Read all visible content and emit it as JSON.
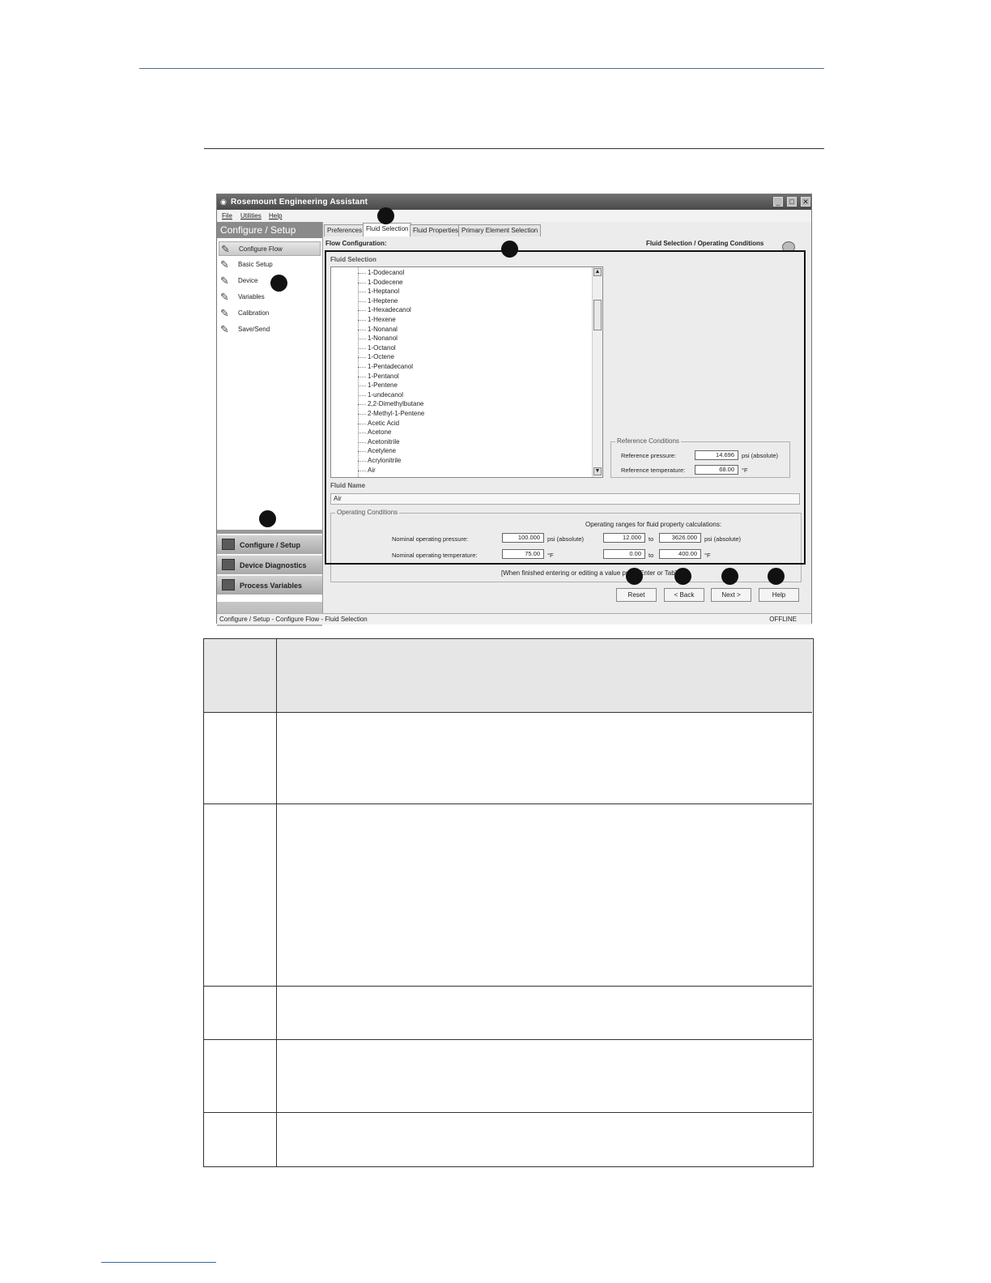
{
  "app": {
    "title": "Rosemount Engineering Assistant",
    "window_buttons": [
      "_",
      "□",
      "✕"
    ],
    "menu": [
      "File",
      "Utilities",
      "Help"
    ],
    "left_panel": {
      "header": "Configure / Setup",
      "nav_items": [
        {
          "label": "Configure Flow",
          "active": true
        },
        {
          "label": "Basic Setup"
        },
        {
          "label": "Device"
        },
        {
          "label": "Variables"
        },
        {
          "label": "Calibration"
        },
        {
          "label": "Save/Send"
        }
      ],
      "big_buttons": [
        "Configure / Setup",
        "Device Diagnostics",
        "Process Variables"
      ]
    },
    "tabs": [
      "Preferences",
      "Fluid Selection",
      "Fluid Properties",
      "Primary Element Selection"
    ],
    "active_tab": "Fluid Selection",
    "flow_configuration_label": "Flow Configuration:",
    "page_heading": "Fluid Selection / Operating Conditions",
    "fluid_selection": {
      "title": "Fluid Selection",
      "items": [
        "1-Dodecanol",
        "1-Dodecene",
        "1-Heptanol",
        "1-Heptene",
        "1-Hexadecanol",
        "1-Hexene",
        "1-Nonanal",
        "1-Nonanol",
        "1-Octanol",
        "1-Octene",
        "1-Pentadecanol",
        "1-Pentanol",
        "1-Pentene",
        "1-undecanol",
        "2,2-Dimethylbutane",
        "2-Methyl-1-Pentene",
        "Acetic Acid",
        "Acetone",
        "Acetonitrile",
        "Acetylene",
        "Acrylonitrile",
        "Air"
      ]
    },
    "reference_conditions": {
      "title": "Reference Conditions",
      "pressure_label": "Reference pressure:",
      "pressure_value": "14.696",
      "pressure_unit": "psi (absolute)",
      "temperature_label": "Reference temperature:",
      "temperature_value": "68.00",
      "temperature_unit": "°F"
    },
    "fluid_name": {
      "title": "Fluid Name",
      "value": "Air"
    },
    "operating_conditions": {
      "title": "Operating Conditions",
      "ranges_label": "Operating ranges for fluid property calculations:",
      "pressure_label": "Nominal operating pressure:",
      "pressure_value": "100.000",
      "pressure_unit": "psi (absolute)",
      "pressure_min": "12.000",
      "pressure_max": "3626.000",
      "pressure_range_unit": "psi (absolute)",
      "temperature_label": "Nominal operating temperature:",
      "temperature_value": "75.00",
      "temperature_unit": "°F",
      "temperature_min": "0.00",
      "temperature_max": "400.00",
      "temperature_range_unit": "°F",
      "to_label": "to"
    },
    "hint": "[When finished entering or editing a value press Enter or Tab]",
    "buttons": {
      "reset": "Reset",
      "back": "< Back",
      "next": "Next >",
      "help": "Help"
    },
    "status": {
      "path": "Configure / Setup - Configure Flow - Fluid Selection",
      "mode": "OFFLINE"
    }
  }
}
